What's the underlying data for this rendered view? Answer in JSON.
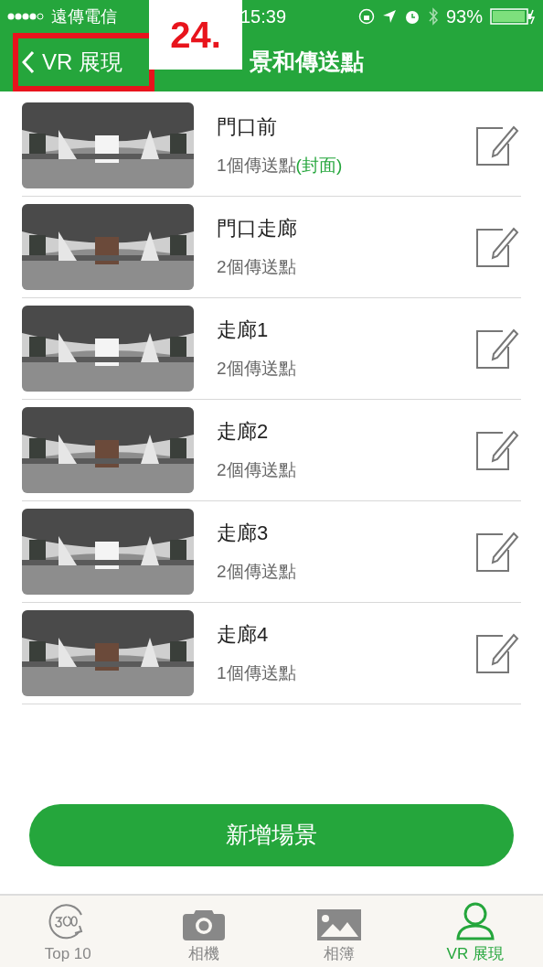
{
  "status_bar": {
    "carrier": "遠傳電信",
    "time": "15:39",
    "battery": "93%"
  },
  "annotation": {
    "label": "24."
  },
  "nav": {
    "back": "VR 展現",
    "title": "景和傳送點"
  },
  "scenes": [
    {
      "name": "門口前",
      "count": "1個傳送點",
      "cover": "(封面)"
    },
    {
      "name": "門口走廊",
      "count": "2個傳送點"
    },
    {
      "name": "走廊1",
      "count": "2個傳送點"
    },
    {
      "name": "走廊2",
      "count": "2個傳送點"
    },
    {
      "name": "走廊3",
      "count": "2個傳送點"
    },
    {
      "name": "走廊4",
      "count": "1個傳送點"
    }
  ],
  "add_button": "新增場景",
  "tabs": [
    {
      "label": "Top 10",
      "kind": "rotate",
      "selected": false
    },
    {
      "label": "相機",
      "kind": "camera",
      "selected": false
    },
    {
      "label": "相簿",
      "kind": "album",
      "selected": false
    },
    {
      "label": "VR 展現",
      "kind": "person",
      "selected": true
    }
  ]
}
